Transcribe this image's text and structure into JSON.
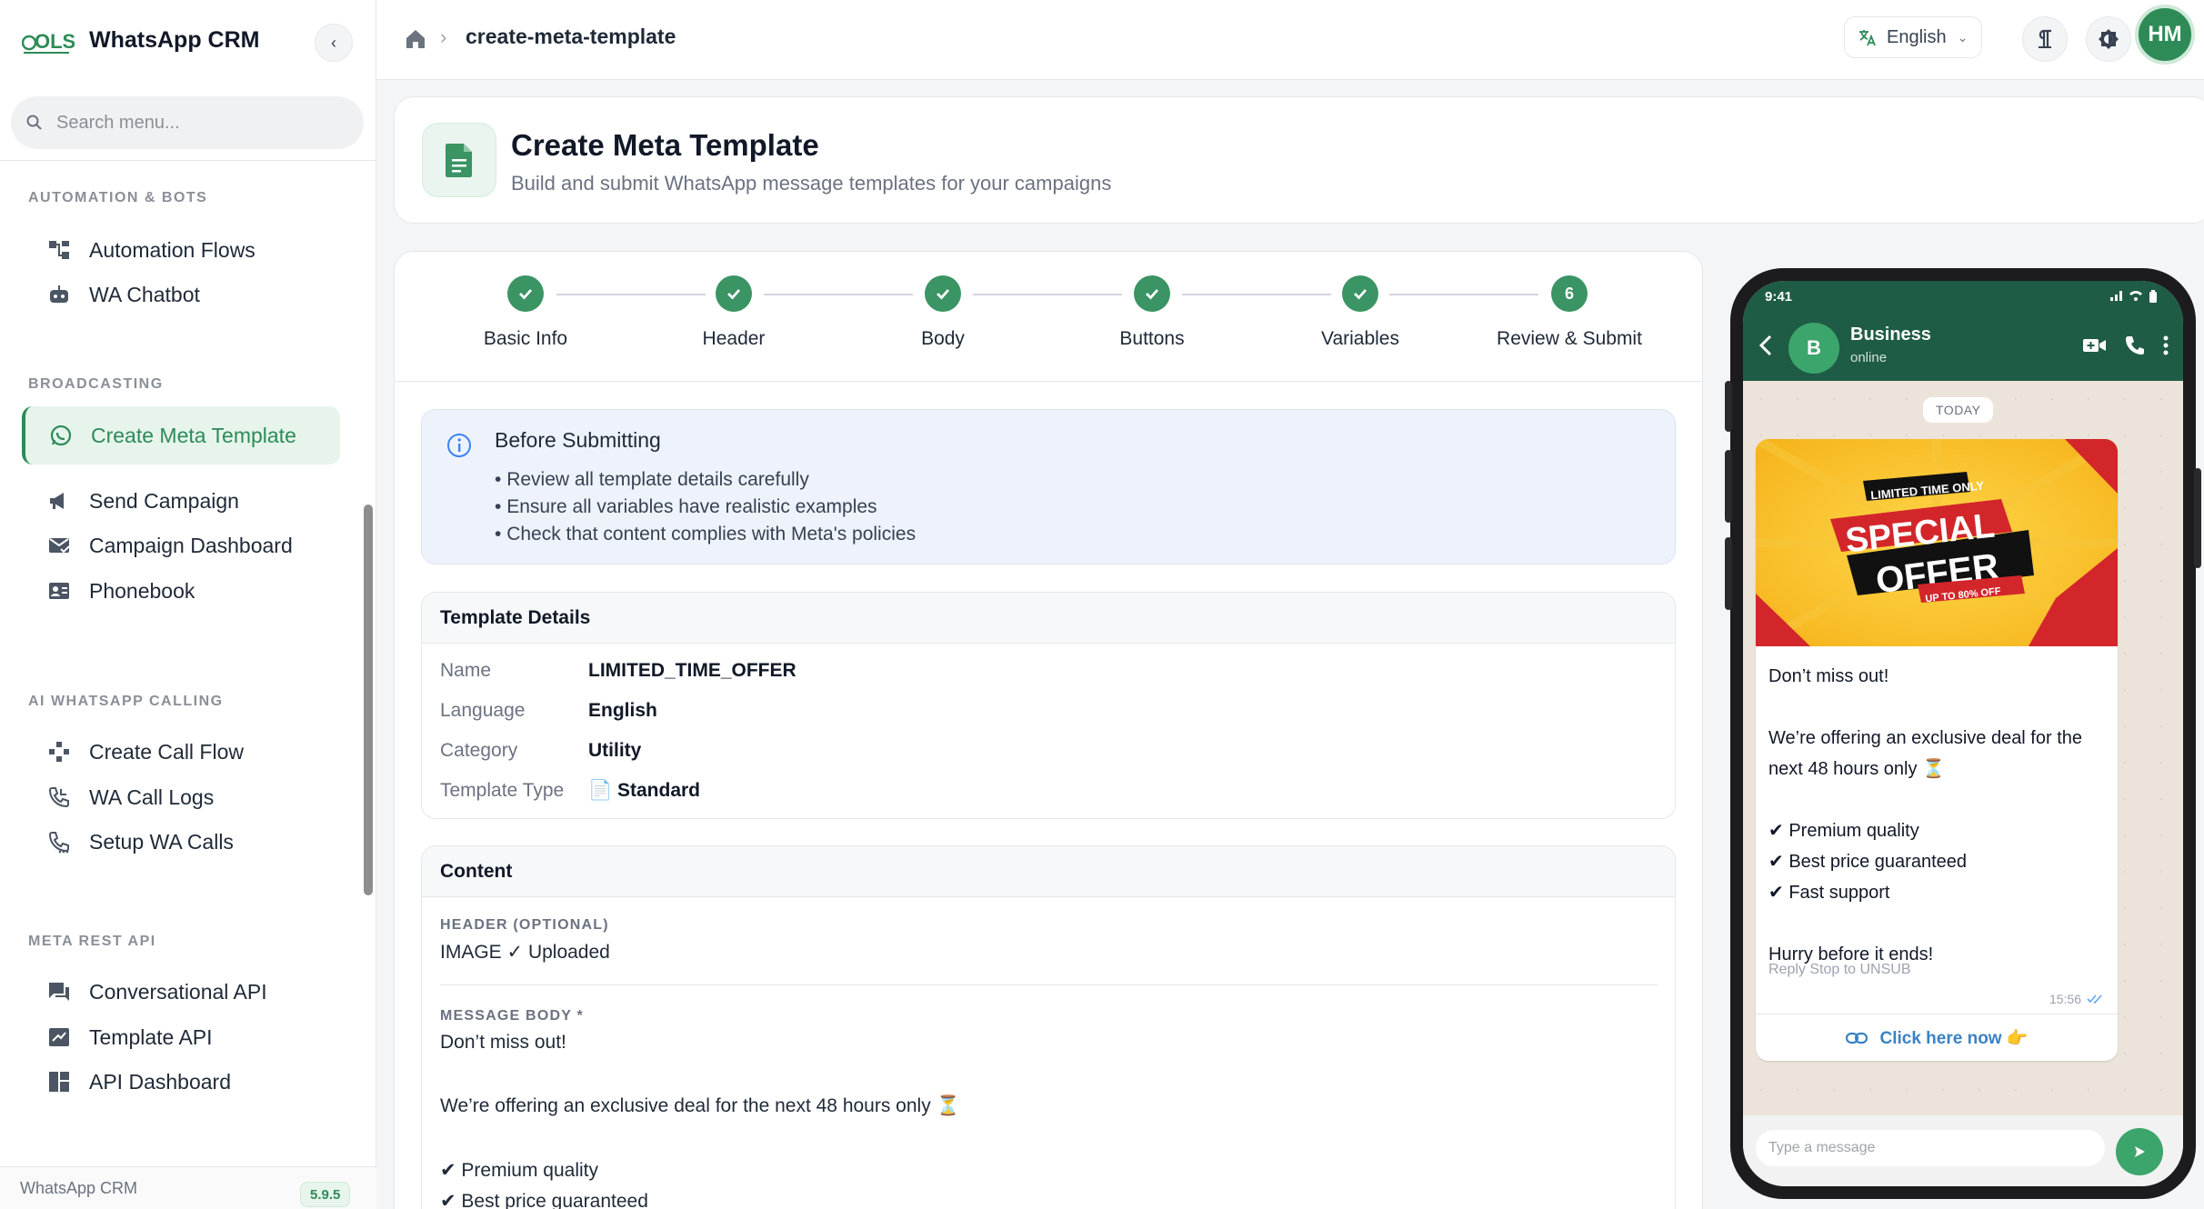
{
  "sidebar": {
    "brand_mark": "OLS",
    "brand_name": "WhatsApp CRM",
    "search_placeholder": "Search menu...",
    "sections": [
      {
        "title": "AUTOMATION & BOTS"
      },
      {
        "title": "BROADCASTING"
      },
      {
        "title": "AI WHATSAPP CALLING"
      },
      {
        "title": "META REST API"
      }
    ],
    "items": [
      {
        "label": "Automation Flows",
        "icon": "flow-icon"
      },
      {
        "label": "WA Chatbot",
        "icon": "robot-icon"
      },
      {
        "label": "Create Meta Template",
        "icon": "whatsapp-icon",
        "active": true
      },
      {
        "label": "Send Campaign",
        "icon": "megaphone-icon"
      },
      {
        "label": "Campaign Dashboard",
        "icon": "mail-check-icon"
      },
      {
        "label": "Phonebook",
        "icon": "contacts-icon"
      },
      {
        "label": "Create Call Flow",
        "icon": "call-flow-icon"
      },
      {
        "label": "WA Call Logs",
        "icon": "call-log-icon"
      },
      {
        "label": "Setup WA Calls",
        "icon": "phone-settings-icon"
      },
      {
        "label": "Conversational API",
        "icon": "chat-icon"
      },
      {
        "label": "Template API",
        "icon": "template-icon"
      },
      {
        "label": "API Dashboard",
        "icon": "dashboard-icon"
      }
    ],
    "footer_name": "WhatsApp CRM",
    "version": "5.9.5"
  },
  "topbar": {
    "breadcrumb_page": "create-meta-template",
    "language": "English",
    "avatar_initials": "HM"
  },
  "page": {
    "title": "Create Meta Template",
    "subtitle": "Build and submit WhatsApp message templates for your campaigns"
  },
  "steps": [
    {
      "label": "Basic Info",
      "done": true
    },
    {
      "label": "Header",
      "done": true
    },
    {
      "label": "Body",
      "done": true
    },
    {
      "label": "Buttons",
      "done": true
    },
    {
      "label": "Variables",
      "done": true
    },
    {
      "label": "Review & Submit",
      "number": "6",
      "done": false
    }
  ],
  "info": {
    "title": "Before Submitting",
    "items": [
      "Review all template details carefully",
      "Ensure all variables have realistic examples",
      "Check that content complies with Meta's policies"
    ]
  },
  "details": {
    "title": "Template Details",
    "rows": [
      {
        "key": "Name",
        "value": "LIMITED_TIME_OFFER"
      },
      {
        "key": "Language",
        "value": "English"
      },
      {
        "key": "Category",
        "value": "Utility"
      },
      {
        "key": "Template Type",
        "value": "📄 Standard"
      }
    ]
  },
  "content": {
    "title": "Content",
    "header_label": "HEADER (OPTIONAL)",
    "header_value": "IMAGE ✓ Uploaded",
    "body_label": "MESSAGE BODY *",
    "body_lines": [
      "Don’t miss out!",
      "We’re offering an exclusive deal for the next 48 hours only ⏳",
      "✔ Premium quality",
      "✔ Best price guaranteed"
    ]
  },
  "preview": {
    "time": "9:41",
    "contact_initial": "B",
    "contact_name": "Business",
    "contact_status": "online",
    "date_chip": "TODAY",
    "promo": {
      "ribbon": "LIMITED TIME ONLY",
      "line1": "SPECIAL",
      "line2": "OFFER",
      "badge": "UP TO 80% OFF"
    },
    "message": "Don’t miss out!\n\nWe’re offering an exclusive deal for the next 48 hours only ⏳\n\n✔ Premium quality\n✔ Best price guaranteed\n✔ Fast support\n\nHurry before it ends!",
    "footer": "Reply Stop to UNSUB",
    "msg_time": "15:56",
    "cta_label": "Click here now 👉",
    "compose_placeholder": "Type a message"
  },
  "colors": {
    "primary_green": "#2e8b57",
    "wa_header": "#1f5c45",
    "info_bg": "#eef3fb"
  }
}
